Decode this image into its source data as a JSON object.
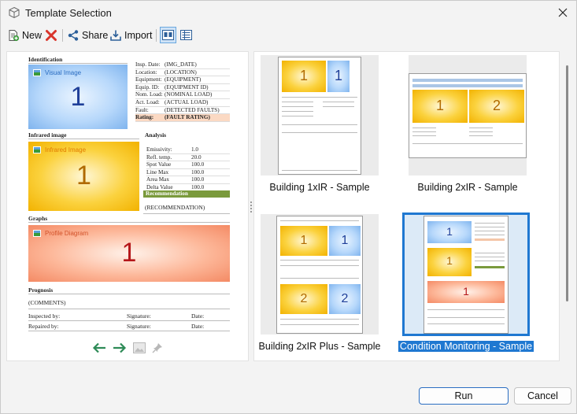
{
  "window": {
    "title": "Template Selection"
  },
  "toolbar": {
    "new_label": "New",
    "share_label": "Share",
    "import_label": "Import"
  },
  "preview": {
    "identification_heading": "Identification",
    "visual_image_label": "Visual Image",
    "visual_number": "1",
    "id_rows": [
      {
        "k": "Insp. Date:",
        "v": "(IMG_DATE)"
      },
      {
        "k": "Location:",
        "v": "(LOCATION)"
      },
      {
        "k": "Equipment:",
        "v": "(EQUIPMENT)"
      },
      {
        "k": "Equip. ID:",
        "v": "(EQUIPMENT ID)"
      },
      {
        "k": "Nom. Load:",
        "v": "(NOMINAL LOAD)"
      },
      {
        "k": "Act. Load:",
        "v": "(ACTUAL LOAD)"
      },
      {
        "k": "Fault:",
        "v": "(DETECTED FAULTS)"
      },
      {
        "k": "Rating:",
        "v": "(FAULT RATING)"
      }
    ],
    "infrared_heading": "Infrared image",
    "infrared_label": "Infrared Image",
    "infrared_number": "1",
    "analysis_heading": "Analysis",
    "analysis_rows": [
      {
        "k": "Emissivity:",
        "v": "1.0"
      },
      {
        "k": "Refl. temp.",
        "v": "20.0"
      },
      {
        "k": "Spot Value",
        "v": "100.0"
      },
      {
        "k": "Line Max",
        "v": "100.0"
      },
      {
        "k": "Area Max",
        "v": "100.0"
      },
      {
        "k": "Delta Value",
        "v": "100.0"
      }
    ],
    "recommendation_heading": "Recommendation",
    "recommendation_text": "(RECOMMENDATION)",
    "graphs_heading": "Graphs",
    "profile_label": "Profile Diagram",
    "profile_number": "1",
    "prognosis_heading": "Prognosis",
    "comments_text": "(COMMENTS)",
    "inspected_by": "Inspected by:",
    "repaired_by": "Repaired by:",
    "signature": "Signature:",
    "date": "Date:"
  },
  "gallery": {
    "tiles": [
      {
        "label": "Building 1xIR - Sample"
      },
      {
        "label": "Building 2xIR - Sample"
      },
      {
        "label": "Building 2xIR Plus - Sample"
      },
      {
        "label": "Condition Monitoring - Sample"
      }
    ],
    "mini_numbers": {
      "one": "1",
      "two": "2"
    }
  },
  "buttons": {
    "run_label": "Run",
    "cancel_label": "Cancel"
  },
  "colors": {
    "accent": "#1f78d1",
    "delete": "#d9342b",
    "nav_arrow": "#2e8b57",
    "recommendation_bar": "#7a9a3c"
  }
}
